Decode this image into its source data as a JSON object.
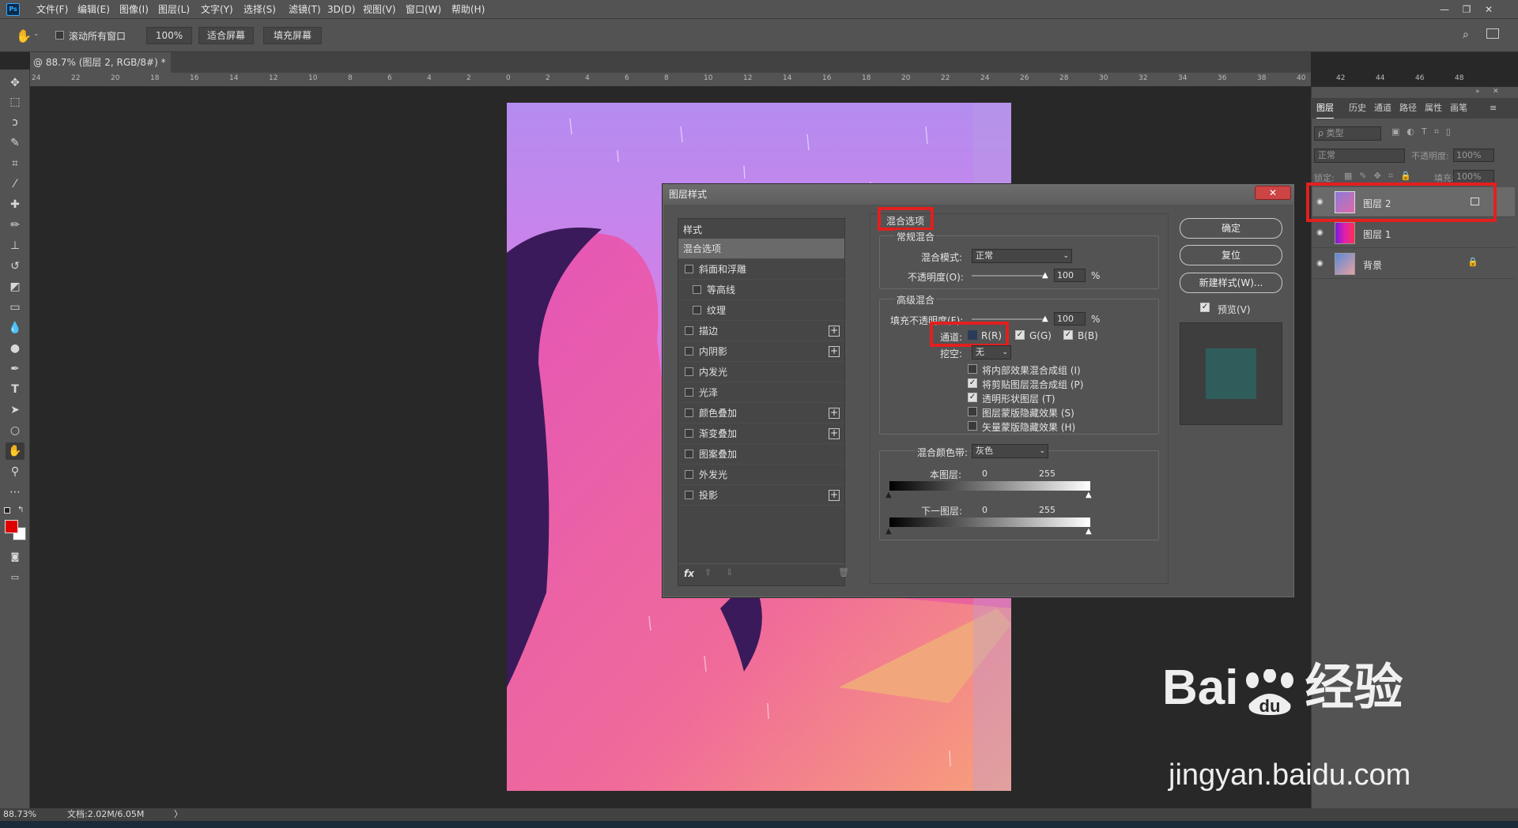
{
  "app": {
    "logo": "Ps"
  },
  "menubar": {
    "items": [
      "文件(F)",
      "编辑(E)",
      "图像(I)",
      "图层(L)",
      "文字(Y)",
      "选择(S)",
      "滤镜(T)",
      "3D(D)",
      "视图(V)",
      "窗口(W)",
      "帮助(H)"
    ],
    "window_controls": [
      "—",
      "❐",
      "✕"
    ]
  },
  "options_bar": {
    "scroll_all_label": "滚动所有窗口",
    "zoom_value": "100%",
    "fit_screen_label": "适合屏幕",
    "fill_screen_label": "填充屏幕"
  },
  "document_tab": {
    "title": "@ 88.7% (图层 2, RGB/8#) *",
    "close": "×"
  },
  "ruler": {
    "h_ticks": [
      "24",
      "22",
      "20",
      "18",
      "16",
      "14",
      "12",
      "10",
      "8",
      "6",
      "4",
      "2",
      "0",
      "2",
      "4",
      "6",
      "8",
      "10",
      "12",
      "14",
      "16",
      "18",
      "20",
      "22",
      "24",
      "26",
      "28",
      "30",
      "32",
      "34",
      "36",
      "38",
      "40",
      "42",
      "44",
      "46",
      "48"
    ]
  },
  "layers_panel": {
    "tabs": [
      "图层",
      "历史",
      "通道",
      "路径",
      "属性",
      "画笔"
    ],
    "filter_label": "ρ 类型",
    "blend_mode": "正常",
    "opacity_label": "不透明度:",
    "opacity_value": "100%",
    "lock_label": "锁定:",
    "fill_label": "填充:",
    "fill_value": "100%",
    "layers": [
      {
        "name": "图层 2",
        "selected": true
      },
      {
        "name": "图层 1",
        "selected": false
      },
      {
        "name": "背景",
        "selected": false,
        "locked": true
      }
    ]
  },
  "status_bar": {
    "zoom": "88.73%",
    "doc_info": "文档:2.02M/6.05M",
    "arrow": "〉"
  },
  "watermark": {
    "brand": "Bai",
    "brand_tail": "经验",
    "url": "jingyan.baidu.com"
  },
  "dialog": {
    "title": "图层样式",
    "close_label": "✕",
    "style_list": {
      "header": "样式",
      "items": [
        {
          "label": "混合选项",
          "checkbox": false,
          "plus": false,
          "active": true,
          "indent": false
        },
        {
          "label": "斜面和浮雕",
          "checkbox": true,
          "plus": false,
          "active": false,
          "indent": false
        },
        {
          "label": "等高线",
          "checkbox": true,
          "plus": false,
          "active": false,
          "indent": true
        },
        {
          "label": "纹理",
          "checkbox": true,
          "plus": false,
          "active": false,
          "indent": true
        },
        {
          "label": "描边",
          "checkbox": true,
          "plus": true,
          "active": false,
          "indent": false
        },
        {
          "label": "内阴影",
          "checkbox": true,
          "plus": true,
          "active": false,
          "indent": false
        },
        {
          "label": "内发光",
          "checkbox": true,
          "plus": false,
          "active": false,
          "indent": false
        },
        {
          "label": "光泽",
          "checkbox": true,
          "plus": false,
          "active": false,
          "indent": false
        },
        {
          "label": "颜色叠加",
          "checkbox": true,
          "plus": true,
          "active": false,
          "indent": false
        },
        {
          "label": "渐变叠加",
          "checkbox": true,
          "plus": true,
          "active": false,
          "indent": false
        },
        {
          "label": "图案叠加",
          "checkbox": true,
          "plus": false,
          "active": false,
          "indent": false
        },
        {
          "label": "外发光",
          "checkbox": true,
          "plus": false,
          "active": false,
          "indent": false
        },
        {
          "label": "投影",
          "checkbox": true,
          "plus": true,
          "active": false,
          "indent": false
        }
      ],
      "fx_label": "fx"
    },
    "blend_options": {
      "section_title": "混合选项",
      "general_title": "常规混合",
      "blend_mode_label": "混合模式:",
      "blend_mode_value": "正常",
      "opacity_label": "不透明度(O):",
      "opacity_value": "100",
      "percent": "%",
      "advanced_title": "高级混合",
      "fill_opacity_label": "填充不透明度(F):",
      "fill_opacity_value": "100",
      "channels_label": "通道:",
      "channel_r": "R(R)",
      "channel_g": "G(G)",
      "channel_b": "B(B)",
      "knockout_label": "挖空:",
      "knockout_value": "无",
      "options": [
        {
          "label": "将内部效果混合成组 (I)",
          "checked": false
        },
        {
          "label": "将剪贴图层混合成组 (P)",
          "checked": true
        },
        {
          "label": "透明形状图层 (T)",
          "checked": true
        },
        {
          "label": "图层蒙版隐藏效果 (S)",
          "checked": false
        },
        {
          "label": "矢量蒙版隐藏效果 (H)",
          "checked": false
        }
      ],
      "blend_if_label": "混合颜色带:",
      "blend_if_value": "灰色",
      "this_layer_label": "本图层:",
      "underlying_label": "下一图层:",
      "range_min": "0",
      "range_max": "255"
    },
    "buttons": {
      "ok": "确定",
      "reset": "复位",
      "new_style": "新建样式(W)...",
      "preview": "预览(V)"
    }
  },
  "colors": {
    "ui_bg": "#535353",
    "highlight_red": "#e21f1f",
    "foreground": "#e00000",
    "background": "#ffffff",
    "preview_swatch": "#2e5d5c"
  }
}
